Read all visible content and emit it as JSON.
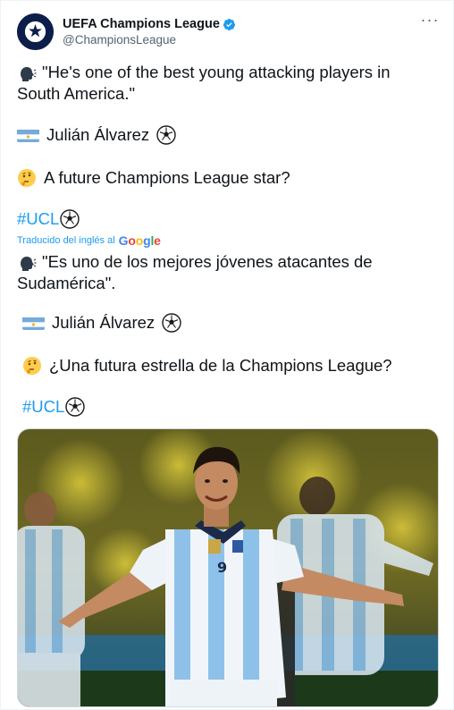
{
  "account": {
    "display_name": "UEFA Champions League",
    "handle": "@ChampionsLeague",
    "verified": true,
    "avatar_icon": "ucl-starball-logo"
  },
  "more_icon": "more-options-icon",
  "original": {
    "line1": "\"He's one of the best young attacking players in South America.\"",
    "line2": "Julián Álvarez",
    "line3": "A future Champions League star?",
    "hashtag": "#UCL"
  },
  "translation_note": {
    "label": "Traducido del inglés al",
    "provider": "Google"
  },
  "translated": {
    "line1": "\"Es uno de los mejores jóvenes atacantes de Sudamérica\".",
    "line2": "Julián Álvarez",
    "line3": "¿Una futura estrella de la Champions League?",
    "hashtag": "#UCL"
  },
  "media": {
    "kind": "photo",
    "description_icon": "player-celebration-photo"
  },
  "colors": {
    "link": "#1d9bf0",
    "verified": "#1d9bf0",
    "text": "#0f1419",
    "secondary": "#536471"
  }
}
